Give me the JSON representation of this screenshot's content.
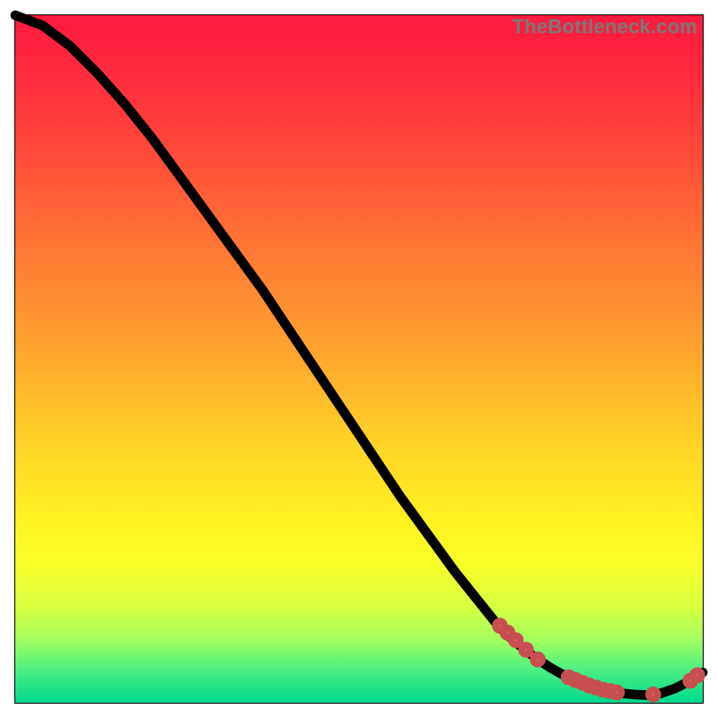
{
  "watermark": "TheBottleneck.com",
  "chart_data": {
    "type": "line",
    "title": "",
    "xlabel": "",
    "ylabel": "",
    "xlim": [
      0,
      100
    ],
    "ylim": [
      0,
      100
    ],
    "legend": false,
    "grid": false,
    "annotations": [],
    "background_gradient": {
      "orientation": "vertical",
      "stops": [
        {
          "pos": 0.0,
          "color": "#ff1a3e"
        },
        {
          "pos": 0.35,
          "color": "#ff7a34"
        },
        {
          "pos": 0.62,
          "color": "#ffd228"
        },
        {
          "pos": 0.8,
          "color": "#f8ff2a"
        },
        {
          "pos": 1.0,
          "color": "#00d890"
        }
      ]
    },
    "series": [
      {
        "name": "bottleneck-curve",
        "x": [
          0,
          4,
          8,
          12,
          16,
          20,
          24,
          28,
          32,
          36,
          40,
          44,
          48,
          52,
          56,
          60,
          64,
          68,
          70,
          72,
          74,
          76,
          78,
          80,
          82,
          84,
          86,
          88,
          90,
          92,
          94,
          96,
          98,
          100
        ],
        "y": [
          100,
          98.5,
          95.5,
          91.5,
          87,
          82,
          76.5,
          71,
          65.5,
          60,
          54,
          48,
          42,
          36,
          30,
          24.5,
          19,
          14,
          11.5,
          9.5,
          7.8,
          6.3,
          5,
          3.9,
          3,
          2.3,
          1.8,
          1.4,
          1.2,
          1.1,
          1.4,
          2.1,
          3.1,
          4.4
        ]
      }
    ],
    "markers": [
      {
        "x": 70.5,
        "y": 11.2
      },
      {
        "x": 71.6,
        "y": 10.2
      },
      {
        "x": 72.8,
        "y": 9.1
      },
      {
        "x": 74.3,
        "y": 7.7
      },
      {
        "x": 76.0,
        "y": 6.3
      },
      {
        "x": 80.5,
        "y": 3.7
      },
      {
        "x": 81.5,
        "y": 3.3
      },
      {
        "x": 82.5,
        "y": 2.9
      },
      {
        "x": 83.5,
        "y": 2.5
      },
      {
        "x": 84.5,
        "y": 2.2
      },
      {
        "x": 85.5,
        "y": 1.9
      },
      {
        "x": 86.5,
        "y": 1.7
      },
      {
        "x": 87.5,
        "y": 1.5
      },
      {
        "x": 92.8,
        "y": 1.2
      },
      {
        "x": 98.2,
        "y": 3.2
      },
      {
        "x": 99.2,
        "y": 4.0
      }
    ],
    "marker_style": {
      "color": "#e06a6a",
      "radius": 5
    }
  }
}
